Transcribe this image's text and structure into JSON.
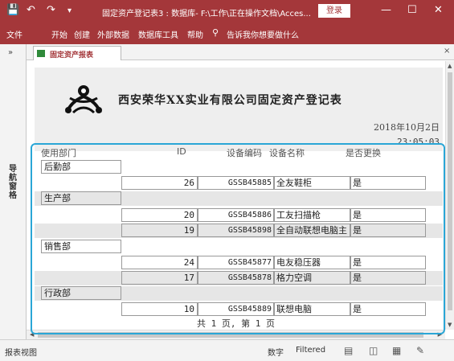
{
  "titlebar": {
    "quick_access": [
      "💾",
      "↶",
      "↷",
      "▾"
    ],
    "title": "固定资产登记表3 : 数据库- F:\\工作\\正在操作文档\\Acces...",
    "login": "登录",
    "controls": [
      "—",
      "☐",
      "✕"
    ]
  },
  "ribbon": {
    "tabs": [
      "文件",
      "开始",
      "创建",
      "外部数据",
      "数据库工具",
      "帮助"
    ],
    "tell_me": "告诉我你想要做什么"
  },
  "navpane": {
    "collapse": "»",
    "label": "导航窗格"
  },
  "document_tab": {
    "label": "固定资产报表",
    "close": "×"
  },
  "report": {
    "title": "西安荣华XX实业有限公司固定资产登记表",
    "date": "2018年10月2日",
    "time": "23:05:03",
    "columns": {
      "dept": "使用部门",
      "id": "ID",
      "code": "设备编码",
      "name": "设备名称",
      "replace": "是否更换"
    },
    "groups": [
      {
        "dept": "后勤部",
        "rows": [
          {
            "id": "26",
            "code": "GSSB45885",
            "name": "全友鞋柜",
            "replace": "是"
          }
        ]
      },
      {
        "dept": "生产部",
        "rows": [
          {
            "id": "20",
            "code": "GSSB45886",
            "name": "工友扫描枪",
            "replace": "是"
          },
          {
            "id": "19",
            "code": "GSSB45898",
            "name": "全自动联想电脑主",
            "replace": "是"
          }
        ]
      },
      {
        "dept": "销售部",
        "rows": [
          {
            "id": "24",
            "code": "GSSB45877",
            "name": "电友稳压器",
            "replace": "是"
          },
          {
            "id": "17",
            "code": "GSSB45878",
            "name": "格力空调",
            "replace": "是"
          }
        ]
      },
      {
        "dept": "行政部",
        "rows": [
          {
            "id": "10",
            "code": "GSSB45889",
            "name": "联想电脑",
            "replace": "是"
          }
        ]
      }
    ],
    "footer": "共 1 页, 第 1 页"
  },
  "statusbar": {
    "view": "报表视图",
    "numlock": "数字",
    "filter": "Filtered"
  },
  "colors": {
    "accent": "#a4373a",
    "highlight": "#2aa6d6",
    "shade": "#e6e6e6"
  }
}
